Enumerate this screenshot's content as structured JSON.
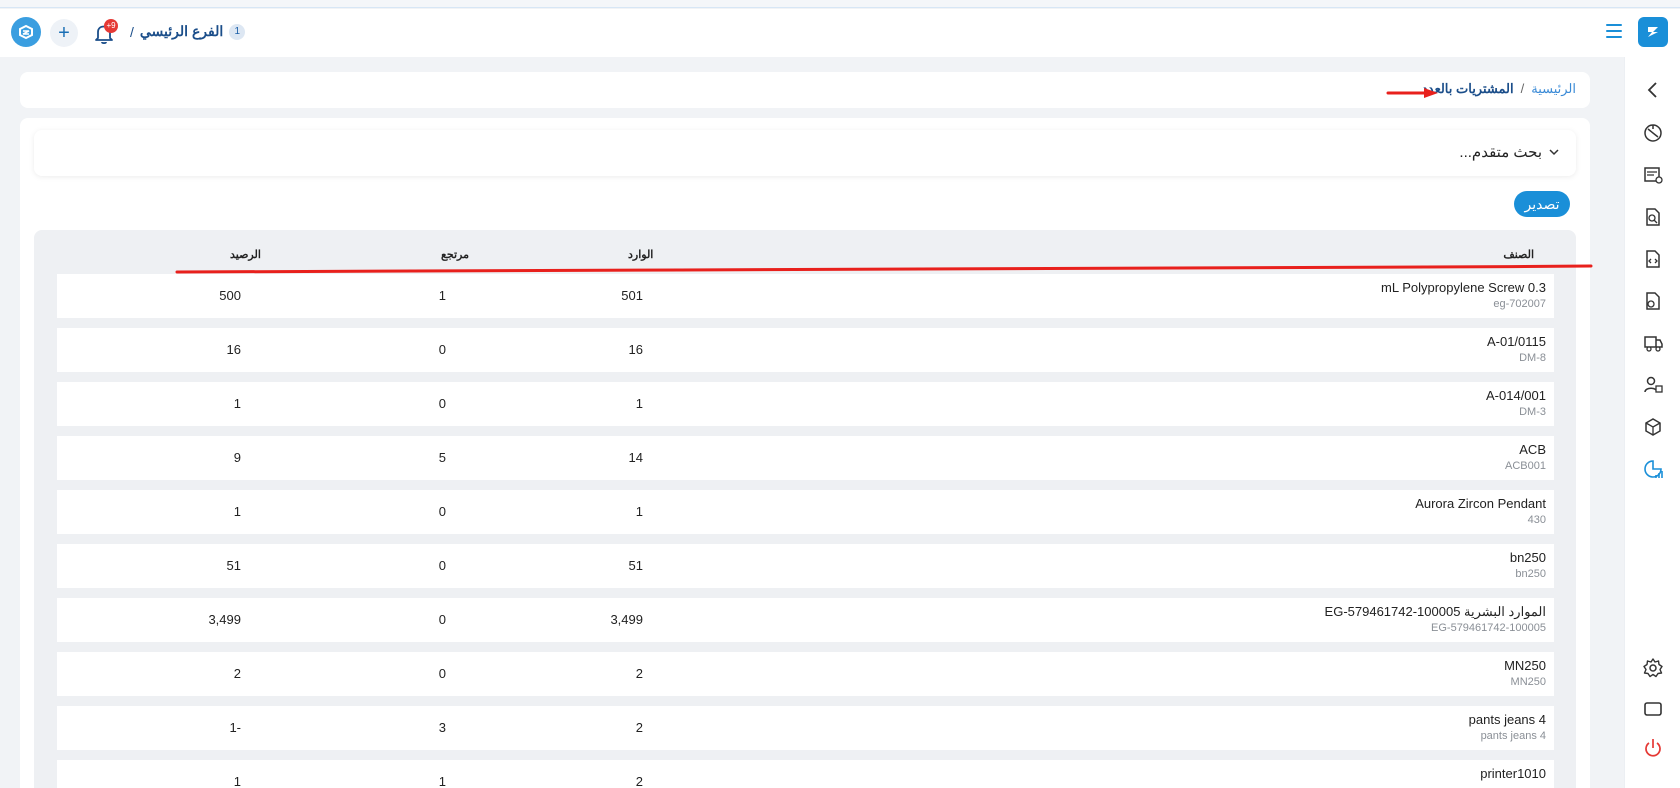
{
  "topbar": {
    "branch_number": "1",
    "branch_name": "الفرع الرئيسي",
    "branch_separator": "/",
    "notifications_count": "+9",
    "add_symbol": "+"
  },
  "breadcrumb": {
    "home": "الرئيسية",
    "separator": "/",
    "current": "المشتريات بالعدد"
  },
  "search": {
    "label": "بحث متقدم..."
  },
  "toolbar": {
    "export_label": "تصدير"
  },
  "table": {
    "headers": {
      "item": "الصنف",
      "incoming": "الوارد",
      "returned": "مرتجع",
      "balance": "الرصيد"
    },
    "rows": [
      {
        "title": "mL Polypropylene Screw 0.3",
        "code": "eg-702007",
        "incoming": "501",
        "returned": "1",
        "balance": "500"
      },
      {
        "title": "A-01/0115",
        "code": "DM-8",
        "incoming": "16",
        "returned": "0",
        "balance": "16"
      },
      {
        "title": "A-014/001",
        "code": "DM-3",
        "incoming": "1",
        "returned": "0",
        "balance": "1"
      },
      {
        "title": "ACB",
        "code": "ACB001",
        "incoming": "14",
        "returned": "5",
        "balance": "9"
      },
      {
        "title": "Aurora Zircon Pendant",
        "code": "430",
        "incoming": "1",
        "returned": "0",
        "balance": "1"
      },
      {
        "title": "bn250",
        "code": "bn250",
        "incoming": "51",
        "returned": "0",
        "balance": "51"
      },
      {
        "title": "EG-579461742-100005 الموارد البشرية",
        "code": "EG-579461742-100005",
        "incoming": "3,499",
        "returned": "0",
        "balance": "3,499"
      },
      {
        "title": "MN250",
        "code": "MN250",
        "incoming": "2",
        "returned": "0",
        "balance": "2"
      },
      {
        "title": "pants jeans 4",
        "code": "pants jeans 4",
        "incoming": "2",
        "returned": "3",
        "balance": "1-"
      },
      {
        "title": "printer1010",
        "code": "",
        "incoming": "2",
        "returned": "1",
        "balance": "1"
      }
    ]
  },
  "sidebar": {
    "icons": [
      "back-chevron-icon",
      "dashboard-icon",
      "invoices-icon",
      "search-document-icon",
      "code-document-icon",
      "document-user-icon",
      "delivery-icon",
      "users-icon",
      "inventory-icon",
      "reports-icon",
      "settings-icon",
      "screen-icon",
      "power-icon"
    ]
  },
  "colors": {
    "accent": "#1a8fd8",
    "annotation": "#e8201c",
    "danger": "#e53935"
  }
}
